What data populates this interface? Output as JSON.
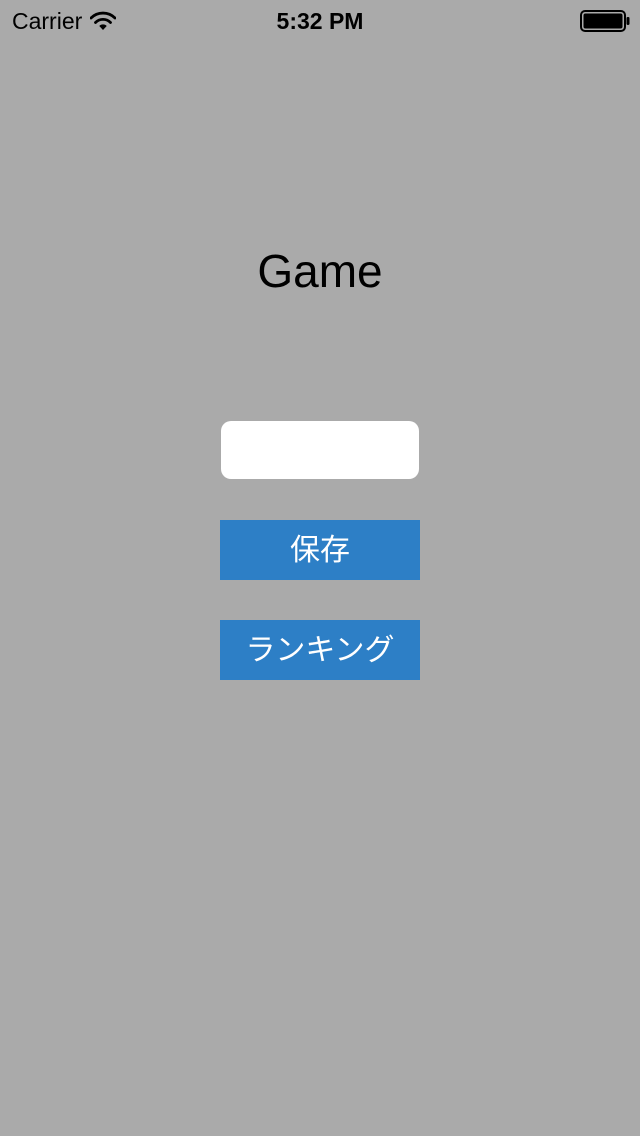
{
  "status_bar": {
    "carrier": "Carrier",
    "time": "5:32 PM",
    "wifi_icon": "wifi-icon",
    "battery_icon": "battery-icon",
    "battery_level": 1.0
  },
  "main": {
    "title": "Game",
    "name_input": {
      "value": "",
      "placeholder": ""
    },
    "save_label": "保存",
    "ranking_label": "ランキング"
  },
  "colors": {
    "background": "#aaaaaa",
    "button": "#2d7fc6",
    "button_text": "#ffffff",
    "input_background": "#ffffff"
  }
}
